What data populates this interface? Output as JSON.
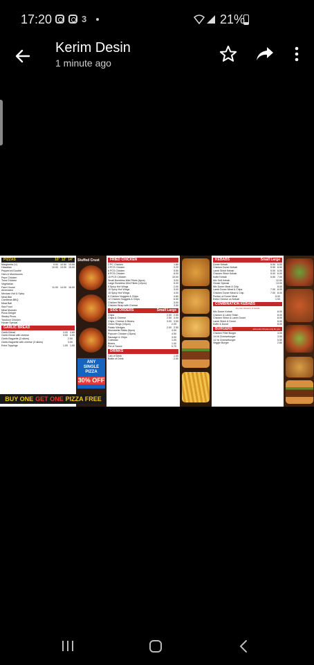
{
  "status": {
    "time": "17:20",
    "battery": "21%"
  },
  "header": {
    "title": "Kerim Desin",
    "subtitle": "1 minute ago"
  },
  "menu": {
    "pizzas": {
      "title": "PIZZAS",
      "sizes": [
        "10'",
        "12'",
        "14'"
      ],
      "items": [
        {
          "name": "Margherita (V)",
          "prices": [
            "9.00",
            "10.50",
            "13.50"
          ]
        },
        {
          "name": "Hawaiian",
          "prices": [
            "10.00",
            "13.00",
            "15.00"
          ]
        },
        {
          "name": "Pepperoni Double",
          "prices": [
            "",
            "",
            ""
          ]
        },
        {
          "name": "Ham & Mushrooms",
          "prices": [
            "",
            "",
            ""
          ]
        },
        {
          "name": "Pepe Chicken",
          "prices": [
            "",
            "",
            ""
          ]
        },
        {
          "name": "Tuna Chicken",
          "prices": [
            "",
            "",
            ""
          ]
        },
        {
          "name": "Vegetarian",
          "prices": [
            "",
            "",
            ""
          ]
        },
        {
          "name": "Farm House",
          "prices": [
            "11.00",
            "14.00",
            "16.00"
          ]
        },
        {
          "name": "Americano",
          "prices": [
            "",
            "",
            ""
          ]
        },
        {
          "name": "Mexican Hot & Spicy",
          "prices": [
            "",
            "",
            ""
          ]
        },
        {
          "name": "Meat Bite",
          "prices": [
            "",
            "",
            ""
          ]
        },
        {
          "name": "Carribean BBQ",
          "prices": [
            "",
            "",
            ""
          ]
        },
        {
          "name": "Meat Ball",
          "prices": [
            "",
            "",
            ""
          ]
        },
        {
          "name": "Sea Food",
          "prices": [
            "",
            "",
            ""
          ]
        },
        {
          "name": "Meat Monster",
          "prices": [
            "",
            "",
            ""
          ]
        },
        {
          "name": "Pizza Delight",
          "prices": [
            "",
            "",
            ""
          ]
        },
        {
          "name": "Steaky Pizza",
          "prices": [
            "",
            "",
            ""
          ]
        },
        {
          "name": "Tandoori Chicken",
          "prices": [
            "",
            "",
            ""
          ]
        },
        {
          "name": "House Special",
          "prices": [
            "",
            "",
            ""
          ]
        }
      ]
    },
    "garlic_bread": {
      "title": "GARLIC BREAD",
      "items": [
        {
          "name": "Garlic Bread",
          "prices": [
            "3.00",
            "3.60"
          ]
        },
        {
          "name": "Garlic Bread with cheese",
          "prices": [
            "3.50",
            "4.00"
          ]
        },
        {
          "name": "Garlic Baguette (3 slices)",
          "prices": [
            "2.50",
            ""
          ]
        },
        {
          "name": "Garlic Baguette with cheese (3 slices)",
          "prices": [
            "3.00",
            ""
          ]
        },
        {
          "name": "Extra Toppings",
          "prices": [
            "1.00",
            "1.00"
          ]
        }
      ]
    },
    "promo": {
      "left": "BUY ONE",
      "mid": "GET ONE",
      "right": "PIZZA FREE"
    },
    "stuffed_crust": "Stuffed Crust",
    "badge": {
      "line1": "ANY",
      "line2": "SINGLE",
      "line3": "PIZZA",
      "off": "30% OFF"
    },
    "fried_chicken": {
      "title": "FRIED CHICKEN",
      "items": [
        {
          "name": "2 PC Chicken",
          "price": "1.80"
        },
        {
          "name": "3 PCS Chicken",
          "price": "3.20"
        },
        {
          "name": "6 PCS Chicken",
          "price": "5.50"
        },
        {
          "name": "8 PCS Chicken",
          "price": "8.00"
        },
        {
          "name": "10 PCS Chicken",
          "price": "10.00"
        },
        {
          "name": "Small Boneless Mini Fillets (6pcs)",
          "price": "3.00"
        },
        {
          "name": "Large Boneless Mini Fillets (12pcs)",
          "price": "5.00"
        },
        {
          "name": "5 Spicy Hot Wings",
          "price": "2.00"
        },
        {
          "name": "10 Spicy Hot Wings",
          "price": "3.00"
        },
        {
          "name": "15 Spicy Hot Wings",
          "price": "4.00"
        },
        {
          "name": "8 Chicken Nuggets & Chips",
          "price": "4.80"
        },
        {
          "name": "12 Chicken Nuggets & Chips",
          "price": "6.50"
        },
        {
          "name": "Chicken Wrap",
          "price": "3.00"
        },
        {
          "name": "Chicken Wrap with Cheese",
          "price": "3.50"
        }
      ]
    },
    "side_orders": {
      "title": "SIDE ORDERS",
      "sizes": [
        "Small",
        "Large"
      ],
      "items": [
        {
          "name": "Chips",
          "prices": [
            "2.00",
            "2.50"
          ]
        },
        {
          "name": "Chips & Cheese",
          "prices": [
            "2.50",
            "3.00"
          ]
        },
        {
          "name": "Chips, Cheese & Beans",
          "prices": [
            "3.00",
            "3.50"
          ]
        },
        {
          "name": "Onion Rings (10pcs)",
          "prices": [
            "2.00",
            ""
          ]
        },
        {
          "name": "Potato Wedges",
          "prices": [
            "2.00",
            "2.50"
          ]
        },
        {
          "name": "Mozzarella Sticks (6pcs)",
          "prices": [
            "4.00",
            ""
          ]
        },
        {
          "name": "Popcorn Chicken (15pcs)",
          "prices": [
            "4.50",
            ""
          ]
        },
        {
          "name": "Sausage & Chips",
          "prices": [
            "3.00",
            ""
          ]
        },
        {
          "name": "Coleslaw",
          "prices": [
            "1.00",
            ""
          ]
        },
        {
          "name": "Beans",
          "prices": [
            "1.00",
            ""
          ]
        },
        {
          "name": "Pot of Sauce",
          "prices": [
            "0.70",
            ""
          ]
        }
      ]
    },
    "drinks": {
      "title": "DRINKS",
      "items": [
        {
          "name": "Can of Drink",
          "price": "1.00"
        },
        {
          "name": "Bottle of Drink",
          "price": "2.50"
        }
      ]
    },
    "kebabs": {
      "title": "KEBABS",
      "sizes": [
        "Small",
        "Large"
      ],
      "items": [
        {
          "name": "Doner Kebab",
          "prices": [
            "5.50",
            "6.50"
          ]
        },
        {
          "name": "Chicken Doner Kebab",
          "prices": [
            "5.50",
            "6.50"
          ]
        },
        {
          "name": "Lamb Shish Kebab",
          "prices": [
            "5.00",
            "6.00"
          ]
        },
        {
          "name": "Chicken Shish Kebab",
          "prices": [
            "5.00",
            "6.00"
          ]
        },
        {
          "name": "Kofte Kebab",
          "prices": [
            "5.50",
            "7.00"
          ]
        },
        {
          "name": "Mix Grill Kebab",
          "prices": [
            "",
            "12.00"
          ]
        },
        {
          "name": "House Special",
          "prices": [
            "",
            "13.00"
          ]
        },
        {
          "name": "Mix Doner Meat & Chip",
          "prices": [
            "",
            "8.00"
          ]
        },
        {
          "name": "Lamb Doner Meat & Chips",
          "prices": [
            "7.00",
            "8.00"
          ]
        },
        {
          "name": "Chicken Doner Meat & Chip",
          "prices": [
            "7.00",
            "8.00"
          ]
        },
        {
          "name": "Portion of Doner Meat",
          "prices": [
            "5.00",
            ""
          ]
        },
        {
          "name": "Extra Cheese on Kebab",
          "prices": [
            "1.00",
            ""
          ]
        }
      ]
    },
    "combination": {
      "title": "COMBINATION KEBABS",
      "subtitle": "any two skewers of kebab",
      "items": [
        {
          "name": "Mix Doner Kebab",
          "price": "8.00"
        },
        {
          "name": "Chicken & Lamb Shish",
          "price": "8.00"
        },
        {
          "name": "Chicken Shish & Lamb Doner",
          "price": "8.00"
        },
        {
          "name": "Lamb Shish & Doner",
          "price": "8.00"
        },
        {
          "name": "Kofte & Doner",
          "price": "8.00"
        }
      ]
    },
    "burgers": {
      "title": "BURGERS",
      "subtitle": "add extra cheese only for you",
      "items": [
        {
          "name": "Chicken Fillet Burger",
          "price": "3.00"
        },
        {
          "name": "1/4 lb Cheeseburger",
          "price": "3.50"
        },
        {
          "name": "1/2 lb Cheeseburger",
          "price": "5.50"
        },
        {
          "name": "Veggie Burger",
          "price": "2.80"
        }
      ]
    }
  }
}
